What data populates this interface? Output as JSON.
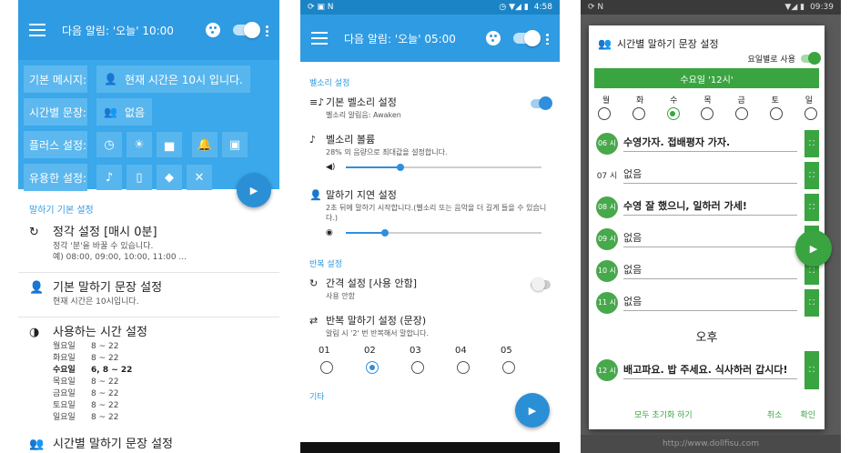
{
  "screen1": {
    "appbar": {
      "title": "다음 알림: '오늘' 10:00"
    },
    "panel": {
      "basic_label": "기본 메시지:",
      "basic_value": "현재 시간은 10시 입니다.",
      "hourly_label": "시간별 문장:",
      "hourly_value": "없음",
      "plus_label": "플러스 설정:",
      "useful_label": "유용한 설정:"
    },
    "section": "말하기 기본 설정",
    "items": [
      {
        "title": "정각 설정 [매시 0분]",
        "sub1": "정각 '분'을 바꿀 수 있습니다.",
        "sub2": "예) 08:00, 09:00, 10:00, 11:00 ..."
      },
      {
        "title": "기본 말하기 문장 설정",
        "sub1": "현재 시간은 10시입니다."
      },
      {
        "title": "사용하는 시간 설정"
      }
    ],
    "schedule": [
      {
        "day": "월요일",
        "range": "8 ~ 22"
      },
      {
        "day": "화요일",
        "range": "8 ~ 22"
      },
      {
        "day": "수요일",
        "range": "6, 8 ~ 22"
      },
      {
        "day": "목요일",
        "range": "8 ~ 22"
      },
      {
        "day": "금요일",
        "range": "8 ~ 22"
      },
      {
        "day": "토요일",
        "range": "8 ~ 22"
      },
      {
        "day": "일요일",
        "range": "8 ~ 22"
      }
    ],
    "cutoff": "시간별 말하기 문장 설정",
    "accent": "#2f9be2"
  },
  "screen2": {
    "status_time": "4:58",
    "appbar": {
      "title": "다음 알림: '오늘' 05:00"
    },
    "sec_ring": "벨소리 설정",
    "ring_title": "기본 벨소리 설정",
    "ring_sub": "벨소리 알림음: Awaken",
    "ring_switch_on": true,
    "vol_title": "벨소리 볼륨",
    "vol_sub": "28% 의 음량으로 최대값을 설정합니다.",
    "vol_level": 0.28,
    "delay_title": "말하기 지연 설정",
    "delay_sub": "2초 뒤에 말하기 시작합니다.(벨소리 또는 음악을 더 길게 들을 수 있습니다.)",
    "delay_level": 0.2,
    "sec_repeat": "반복 설정",
    "interval_title": "간격 설정 [사용 안함]",
    "interval_sub": "사용 안함",
    "interval_switch_on": false,
    "repeat_title": "반복 말하기 설정 (문장)",
    "repeat_sub": "알림 시 '2' 번 반복해서 말합니다.",
    "repeat_options": [
      "01",
      "02",
      "03",
      "04",
      "05"
    ],
    "repeat_selected": 1,
    "sec_other": "기타"
  },
  "screen3": {
    "status_time": "09:39",
    "title": "시간별 말하기 문장 설정",
    "day_toggle_label": "요일별로 사용",
    "day_bar": "수요일 '12시'",
    "weekdays": [
      "월",
      "화",
      "수",
      "목",
      "금",
      "토",
      "일"
    ],
    "weekday_selected": 2,
    "hours": [
      {
        "hour": "06 시",
        "text": "수영가자. 접배평자 가자.",
        "badge": true,
        "bold": true
      },
      {
        "hour": "07 시",
        "text": "없음",
        "badge": false,
        "bold": false
      },
      {
        "hour": "08 시",
        "text": "수영 잘 했으니, 일하러 가세!",
        "badge": true,
        "bold": true
      },
      {
        "hour": "09 시",
        "text": "없음",
        "badge": true,
        "bold": false
      },
      {
        "hour": "10 시",
        "text": "없음",
        "badge": true,
        "bold": false
      },
      {
        "hour": "11 시",
        "text": "없음",
        "badge": true,
        "bold": false
      }
    ],
    "pm_label": "오후",
    "pm_hour": {
      "hour": "12 시",
      "text": "배고파요. 밥 주세요. 식사하러 갑시다!"
    },
    "reset_label": "모두 초기화 하기",
    "cancel_label": "취소",
    "ok_label": "확인",
    "bottom_text": "http://www.dollfisu.com",
    "accent": "#3aa441"
  }
}
